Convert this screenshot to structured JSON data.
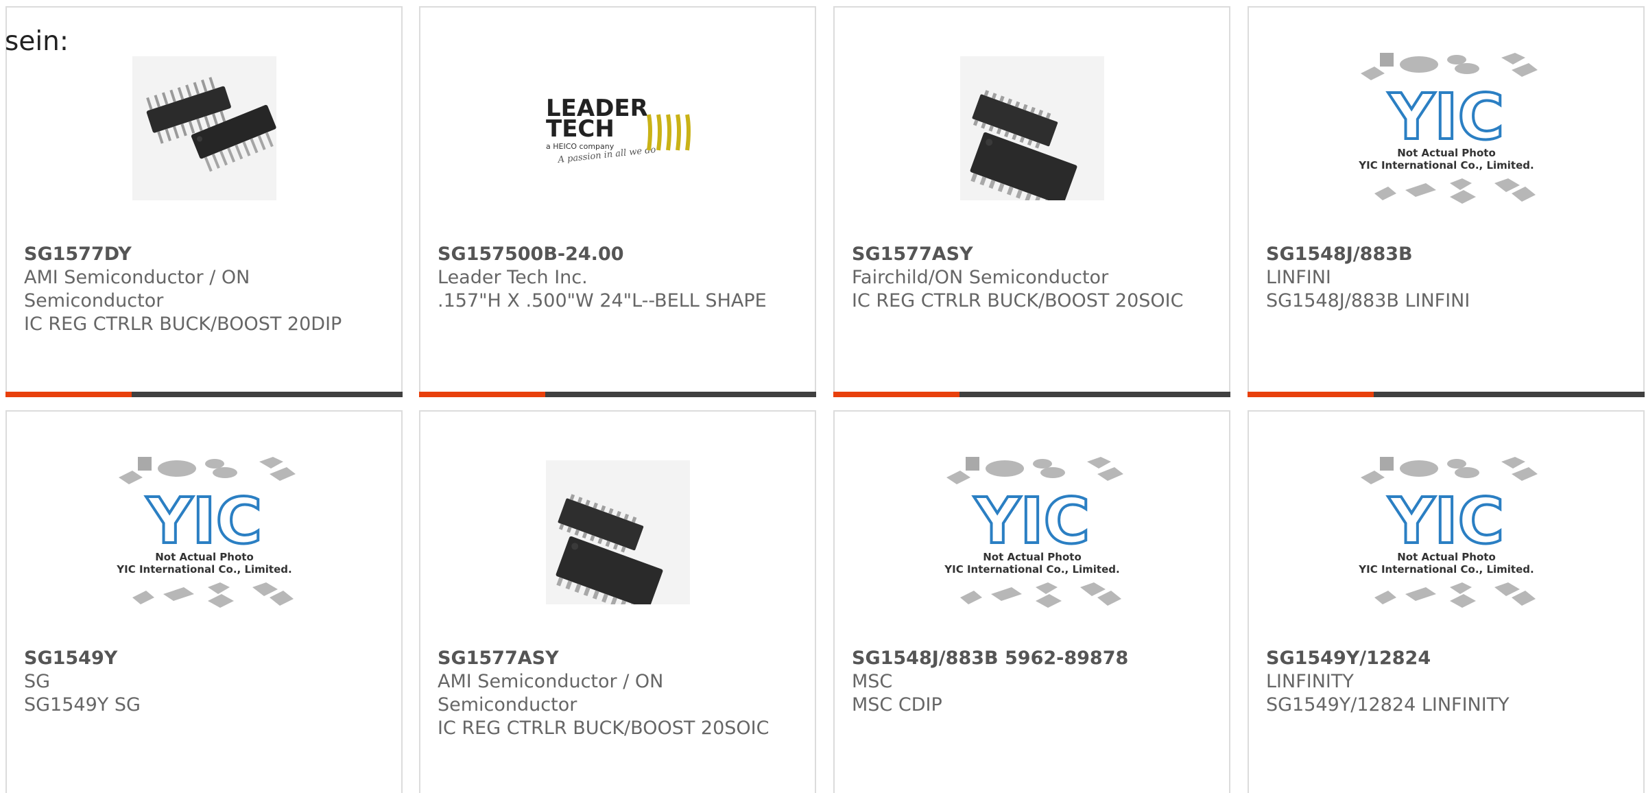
{
  "intro_text": "sein:",
  "products": [
    {
      "part": "SG1577DY",
      "manufacturer": "AMI Semiconductor / ON Semiconductor",
      "description": "IC REG CTRLR BUCK/BOOST 20DIP",
      "image": "dip-chip-photo"
    },
    {
      "part": "SG157500B-24.00",
      "manufacturer": "Leader Tech Inc.",
      "description": ".157\"H X .500\"W 24\"L--BELL SHAPE",
      "image": "leader-tech-logo",
      "logo": {
        "line1": "LEADER",
        "line2": "TECH",
        "line3": "a HEICO company",
        "tagline": "A passion in all we do"
      }
    },
    {
      "part": "SG1577ASY",
      "manufacturer": "Fairchild/ON Semiconductor",
      "description": "IC REG CTRLR BUCK/BOOST 20SOIC",
      "image": "soic-chip-photo"
    },
    {
      "part": "SG1548J/883B",
      "manufacturer": "LINFINI",
      "description": "SG1548J/883B LINFINI",
      "image": "yic-placeholder"
    },
    {
      "part": "SG1549Y",
      "manufacturer": "SG",
      "description": "SG1549Y SG",
      "image": "yic-placeholder"
    },
    {
      "part": "SG1577ASY",
      "manufacturer": "AMI Semiconductor / ON Semiconductor",
      "description": "IC REG CTRLR BUCK/BOOST 20SOIC",
      "image": "soic-chip-photo"
    },
    {
      "part": "SG1548J/883B 5962-89878",
      "manufacturer": "MSC",
      "description": "MSC CDIP",
      "image": "yic-placeholder"
    },
    {
      "part": "SG1549Y/12824",
      "manufacturer": "LINFINITY",
      "description": "SG1549Y/12824 LINFINITY",
      "image": "yic-placeholder"
    }
  ],
  "placeholder": {
    "line1": "Not Actual Photo",
    "line2": "YIC International Co., Limited.",
    "logo_text": "YIC"
  },
  "colors": {
    "accent": "#e8400c",
    "bar": "#404040",
    "text": "#666666",
    "part": "#555555",
    "border": "#dcdcdc"
  }
}
